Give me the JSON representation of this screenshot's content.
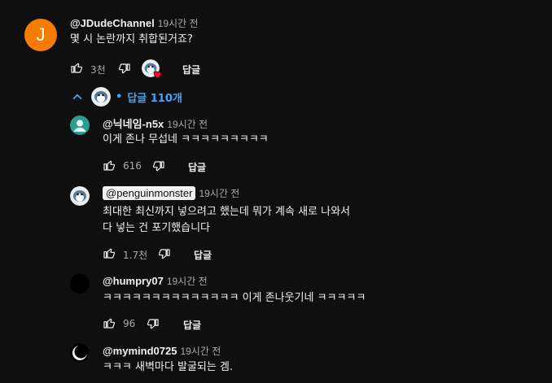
{
  "top_comment": {
    "avatar_letter": "J",
    "handle": "@JDudeChannel",
    "time": "19시간 전",
    "text": "몇 시 논란까지 취합된거죠?",
    "likes": "3천",
    "reply_label": "답글"
  },
  "replies_toggle": {
    "label": "답글 110개"
  },
  "replies": [
    {
      "handle": "@닉네임-n5x",
      "time": "19시간 전",
      "text_lines": [
        "이게 존나 무섭네 ㅋㅋㅋㅋㅋㅋㅋㅋㅋ"
      ],
      "likes": "616",
      "reply_label": "답글"
    },
    {
      "handle": "@penguinmonster",
      "time": "19시간 전",
      "text_lines": [
        "최대한 최신까지 넣으려고 했는데 뭐가 계속 새로 나와서",
        "다 넣는 건 포기했습니다"
      ],
      "likes": "1.7천",
      "reply_label": "답글"
    },
    {
      "handle": "@humpry07",
      "time": "19시간 전",
      "text_lines": [
        "ㅋㅋㅋㅋㅋㅋㅋㅋㅋㅋㅋㅋㅋㅋ 이게 존나웃기네 ㅋㅋㅋㅋㅋ"
      ],
      "likes": "96",
      "reply_label": "답글"
    },
    {
      "handle": "@mymind0725",
      "time": "19시간 전",
      "text_lines": [
        "ㅋㅋㅋ 새벽마다 발굴되는 겜."
      ]
    }
  ],
  "colors": {
    "background": "#0f0f0f",
    "text": "#f1f1f1",
    "muted": "#aaaaaa",
    "link_blue": "#3ea6ff",
    "avatar_orange": "#f57c00",
    "heart_red": "#ff0033"
  }
}
